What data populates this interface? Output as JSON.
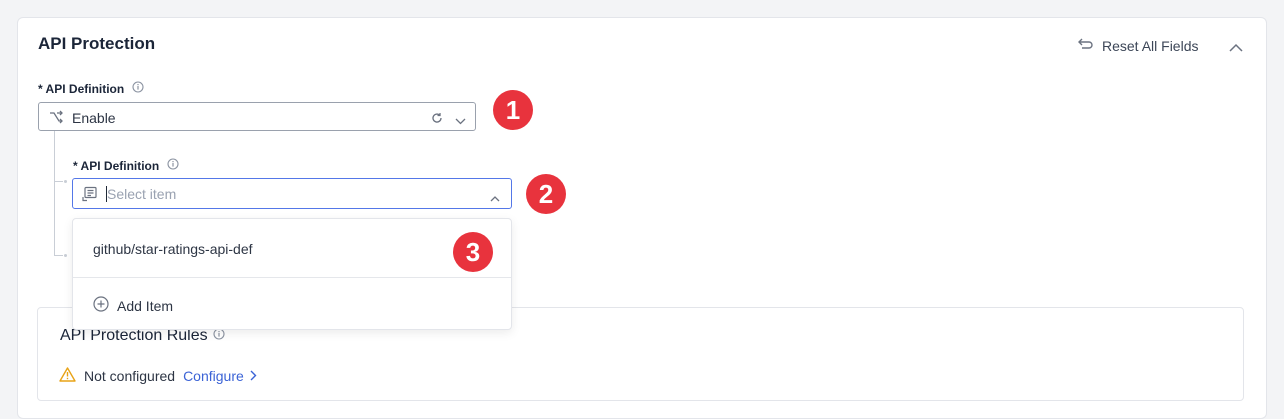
{
  "section": {
    "title": "API Protection",
    "reset_label": "Reset All Fields"
  },
  "field1": {
    "label": "* API Definition",
    "value": "Enable"
  },
  "field2": {
    "label": "* API Definition",
    "placeholder": "Select item"
  },
  "dropdown": {
    "options": [
      "github/star-ratings-api-def"
    ],
    "add_label": "Add Item"
  },
  "annotations": [
    "1",
    "2",
    "3"
  ],
  "rules": {
    "title": "API Protection Rules",
    "status": "Not configured",
    "configure_label": "Configure"
  },
  "colors": {
    "badge": "#e8333d",
    "link": "#3b63d6",
    "focus_border": "#5477e8",
    "warning": "#e8a317"
  }
}
